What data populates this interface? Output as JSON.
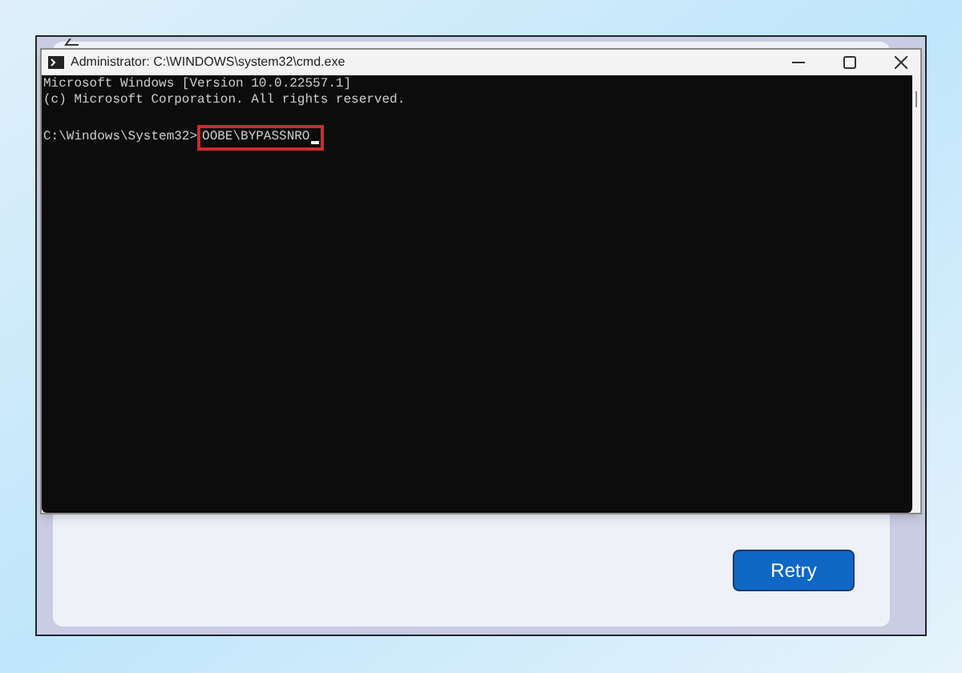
{
  "console_window": {
    "title": "Administrator: C:\\WINDOWS\\system32\\cmd.exe",
    "lines": [
      "Microsoft Windows [Version 10.0.22557.1]",
      "(c) Microsoft Corporation. All rights reserved."
    ],
    "prompt": "C:\\Windows\\System32>",
    "command": "OOBE\\BYPASSNRO",
    "command_highlighted": true
  },
  "setup_dialog": {
    "buttons": [
      "Retry"
    ]
  }
}
